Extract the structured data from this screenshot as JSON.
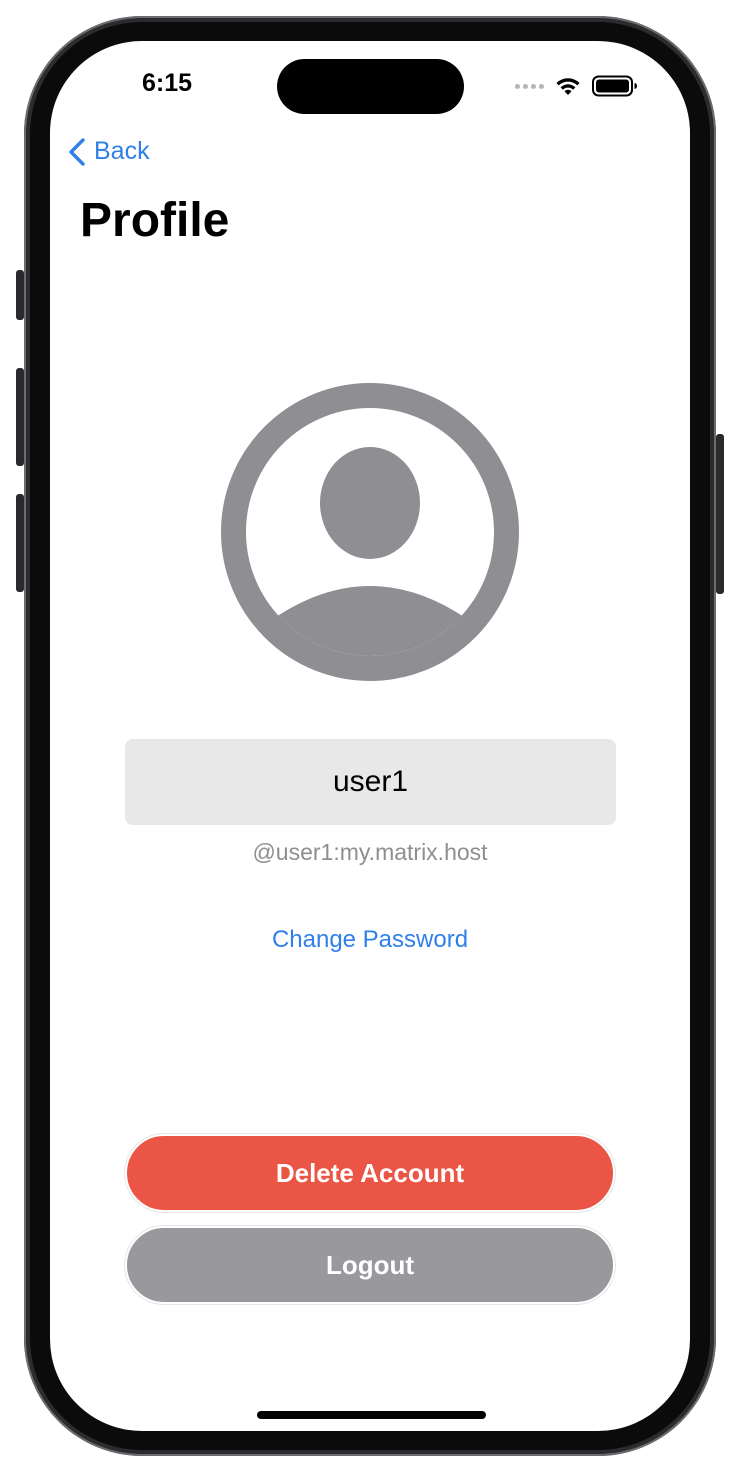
{
  "status_bar": {
    "time": "6:15"
  },
  "nav": {
    "back_label": "Back",
    "back_icon": "chevron-left-icon"
  },
  "page": {
    "title": "Profile"
  },
  "profile": {
    "avatar_icon": "person-circle-icon",
    "display_name": "user1",
    "user_id": "@user1:my.matrix.host",
    "change_password_label": "Change Password"
  },
  "actions": {
    "delete_label": "Delete Account",
    "logout_label": "Logout"
  },
  "colors": {
    "accent": "#2f80e9",
    "delete": "#ea5545",
    "logout": "#98989d",
    "avatar": "#8e8e93",
    "field_bg": "#e8e8e8"
  }
}
